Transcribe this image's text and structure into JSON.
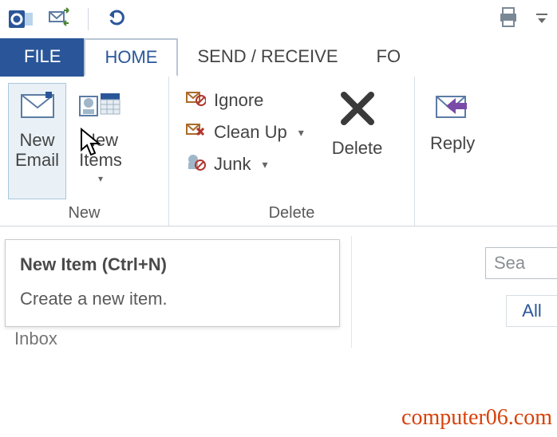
{
  "titlebar": {
    "app": "Outlook"
  },
  "tabs": {
    "file": "FILE",
    "home": "HOME",
    "send_receive": "SEND / RECEIVE",
    "folder_cut": "FO"
  },
  "ribbon": {
    "new": {
      "caption": "New",
      "new_email": "New\nEmail",
      "new_items": "New\nItems"
    },
    "delete": {
      "caption": "Delete",
      "ignore": "Ignore",
      "cleanup": "Clean Up",
      "junk": "Junk",
      "delete": "Delete"
    },
    "respond": {
      "reply": "Reply"
    }
  },
  "tooltip": {
    "title": "New Item (Ctrl+N)",
    "desc": "Create a new item."
  },
  "nav": {
    "inbox": "Inbox"
  },
  "list": {
    "search_placeholder": "Sea",
    "filter_all": "All"
  },
  "watermark": "computer06.com"
}
